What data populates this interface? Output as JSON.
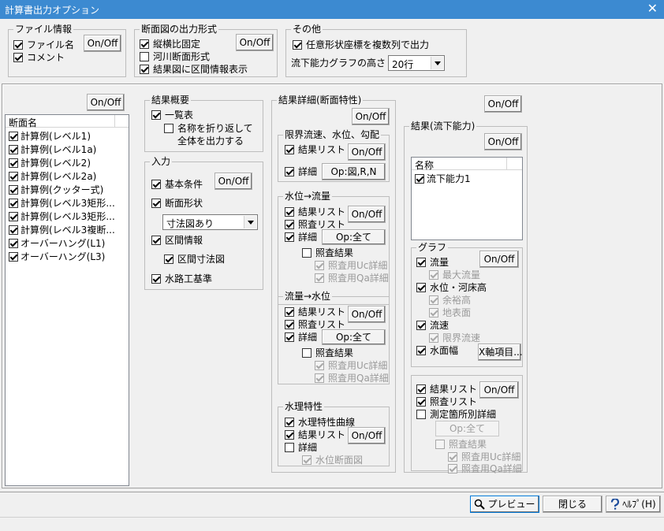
{
  "window": {
    "title": "計算書出力オプション",
    "close": "✕"
  },
  "common": {
    "onoff": "On/Off"
  },
  "file_info": {
    "legend": "ファイル情報",
    "items": [
      {
        "label": "ファイル名",
        "checked": true
      },
      {
        "label": "コメント",
        "checked": true
      }
    ]
  },
  "section_format": {
    "legend": "断面図の出力形式",
    "items": [
      {
        "label": "縦横比固定",
        "checked": true
      },
      {
        "label": "河川断面形式",
        "checked": false
      },
      {
        "label": "結果図に区間情報表示",
        "checked": true
      }
    ]
  },
  "other": {
    "legend": "その他",
    "item": {
      "label": "任意形状座標を複数列で出力",
      "checked": true
    },
    "graph_height_label": "流下能力グラフの高さ",
    "graph_height_value": "20行"
  },
  "section_list": {
    "header": "断面名",
    "items": [
      "計算例(レベル1)",
      "計算例(レベル1a)",
      "計算例(レベル2)",
      "計算例(レベル2a)",
      "計算例(クッター式)",
      "計算例(レベル3矩形...",
      "計算例(レベル3矩形...",
      "計算例(レベル3複断...",
      "オーバーハング(L1)",
      "オーバーハング(L3)"
    ]
  },
  "summary": {
    "legend": "結果概要",
    "list": "一覧表",
    "wrap_line1": "名称を折り返して",
    "wrap_line2": "全体を出力する"
  },
  "input": {
    "legend": "入力",
    "basic": "基本条件",
    "shape": "断面形状",
    "shape_combo": "寸法図あり",
    "interval": "区間情報",
    "interval_dim": "区間寸法図",
    "standard": "水路工基準"
  },
  "detail": {
    "legend": "結果詳細(断面特性)",
    "critical": {
      "legend": "限界流速、水位、勾配",
      "list": "結果リスト",
      "detail": "詳細",
      "op": "Op:図,R,N"
    },
    "wl_to_q": {
      "legend": "水位→流量",
      "list": "結果リスト",
      "check": "照査リスト",
      "detail": "詳細",
      "op": "Op:全て",
      "res": "照査結果",
      "uc": "照査用Uc詳細",
      "qa": "照査用Qa詳細"
    },
    "q_to_wl": {
      "legend": "流量→水位",
      "list": "結果リスト",
      "check": "照査リスト",
      "detail": "詳細",
      "op": "Op:全て",
      "res": "照査結果",
      "uc": "照査用Uc詳細",
      "qa": "照査用Qa詳細"
    },
    "hydraulic": {
      "legend": "水理特性",
      "curve": "水理特性曲線",
      "list": "結果リスト",
      "detail": "詳細",
      "wl": "水位断面図"
    }
  },
  "capacity": {
    "legend": "結果(流下能力)",
    "header": "名称",
    "item": "流下能力1",
    "graph": {
      "legend": "グラフ",
      "flow": "流量",
      "max_flow": "最大流量",
      "level": "水位・河床高",
      "margin": "余裕高",
      "ground": "地表面",
      "velocity": "流速",
      "crit_vel": "限界流速",
      "width": "水面幅",
      "xaxis": "X軸項目..."
    },
    "list": "結果リスト",
    "check": "照査リスト",
    "measure": "測定箇所別詳細",
    "op": "Op:全て",
    "res": "照査結果",
    "uc": "照査用Uc詳細",
    "qa": "照査用Qa詳細"
  },
  "footer": {
    "preview": "プレビュー",
    "close": "閉じる",
    "help": "ﾍﾙﾌﾟ(H)"
  }
}
